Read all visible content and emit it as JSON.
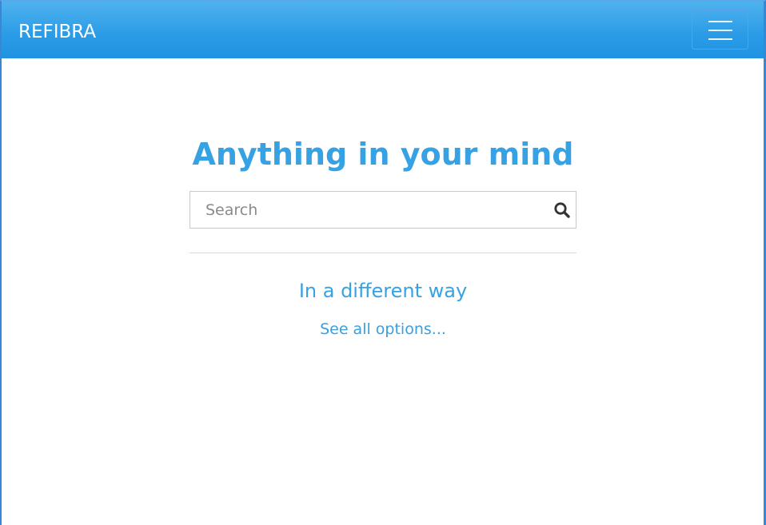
{
  "navbar": {
    "brand": "REFIBRA",
    "toggle_icon": "hamburger-menu-icon"
  },
  "hero": {
    "title": "Anything in your mind"
  },
  "search": {
    "placeholder": "Search",
    "value": "",
    "icon": "search-icon"
  },
  "alternative": {
    "title": "In a different way",
    "link_label": "See all options..."
  },
  "colors": {
    "accent": "#37a2e3",
    "navbar_top": "#4eb2ee",
    "navbar_bottom": "#1f93e2",
    "frame": "#3a86d4"
  }
}
